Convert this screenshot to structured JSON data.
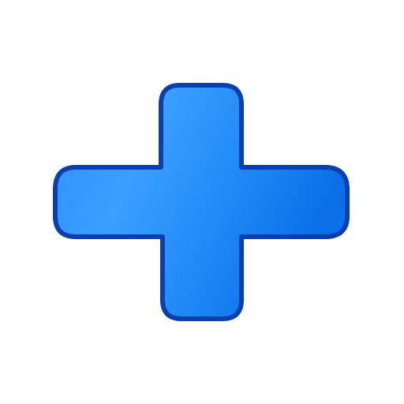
{
  "icon": {
    "name": "plus-icon",
    "colors": {
      "fill_light": "#3aa0ff",
      "fill_mid": "#1e88f5",
      "fill_dark": "#0a6fe8",
      "outline": "#0b3fb0",
      "background": "#ffffff"
    }
  }
}
